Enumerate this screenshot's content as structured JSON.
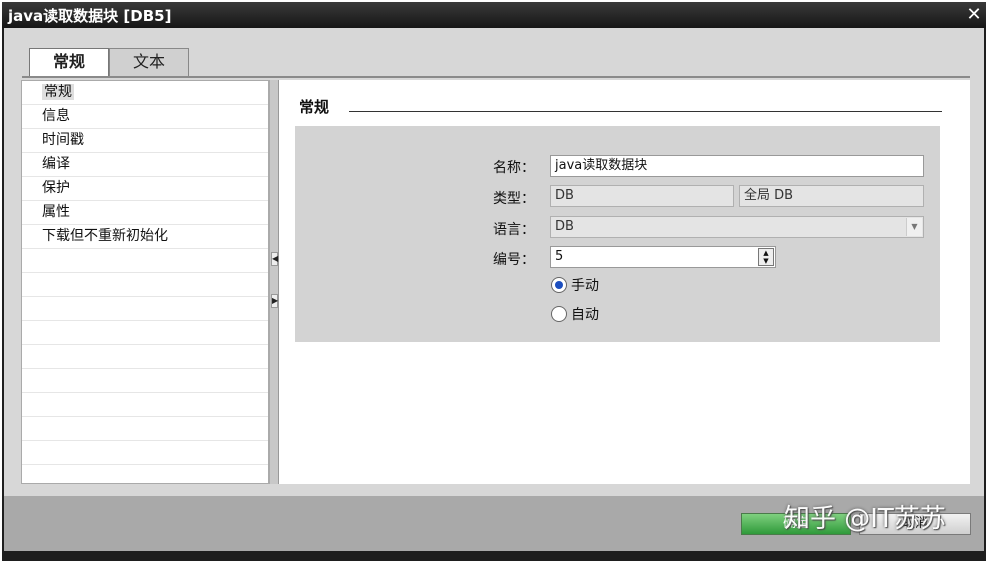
{
  "window": {
    "title": "java读取数据块 [DB5]",
    "close_icon": "close-icon"
  },
  "tabs": [
    {
      "label": "常规",
      "active": true
    },
    {
      "label": "文本",
      "active": false
    }
  ],
  "sidebar": {
    "items": [
      {
        "label": "常规",
        "active": true
      },
      {
        "label": "信息"
      },
      {
        "label": "时间戳"
      },
      {
        "label": "编译"
      },
      {
        "label": "保护"
      },
      {
        "label": "属性"
      },
      {
        "label": "下载但不重新初始化"
      }
    ]
  },
  "section": {
    "title": "常规"
  },
  "form": {
    "name_label": "名称：",
    "name_value": "java读取数据块",
    "type_label": "类型：",
    "type_value": "DB",
    "type_scope": "全局 DB",
    "language_label": "语言：",
    "language_value": "DB",
    "number_label": "编号：",
    "number_value": "5",
    "radio_manual": "手动",
    "radio_auto": "自动",
    "selected_mode": "manual"
  },
  "footer": {
    "ok_label": "确定",
    "cancel_label": "取消"
  },
  "watermark": "知乎 @IT苏苏",
  "colors": {
    "accent": "#2f9a3a",
    "title_bg": "#1e1e1e",
    "panel_bg": "#d3d3d3"
  }
}
